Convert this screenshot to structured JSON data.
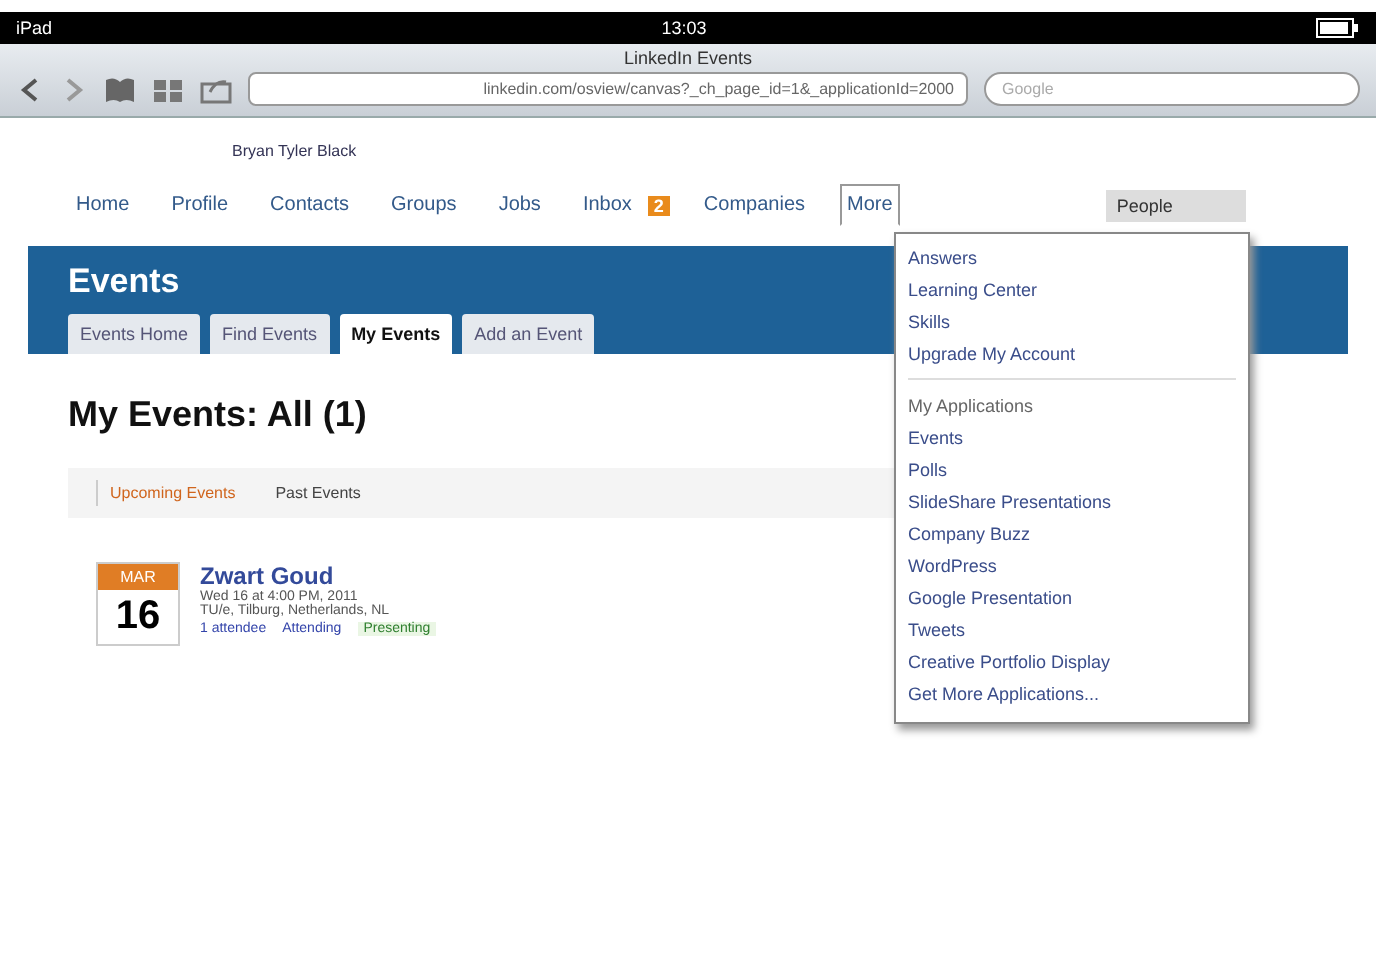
{
  "status_bar": {
    "device": "iPad",
    "time": "13:03"
  },
  "browser": {
    "title": "LinkedIn Events",
    "url": "linkedin.com/osview/canvas?_ch_page_id=1&_applicationId=2000",
    "search_placeholder": "Google"
  },
  "greeting": "Bryan Tyler Black",
  "nav": [
    {
      "label": "Home",
      "selected": false
    },
    {
      "label": "Profile",
      "selected": false
    },
    {
      "label": "Contacts",
      "selected": false
    },
    {
      "label": "Groups",
      "selected": false
    },
    {
      "label": "Jobs",
      "selected": false
    },
    {
      "label": "Inbox",
      "selected": false,
      "badge": "2"
    },
    {
      "label": "Companies",
      "selected": false
    },
    {
      "label": "More",
      "selected": true
    }
  ],
  "people_search": {
    "placeholder": "People"
  },
  "header": {
    "title": "Events"
  },
  "tabs": [
    {
      "label": "Events Home",
      "selected": false
    },
    {
      "label": "Find Events",
      "selected": false
    },
    {
      "label": "My Events",
      "selected": true
    },
    {
      "label": "Add an Event",
      "selected": false
    }
  ],
  "heading": "My Events: All (1)",
  "subtabs": [
    {
      "label": "Upcoming Events",
      "selected": true
    },
    {
      "label": "Past Events",
      "selected": false
    }
  ],
  "events": [
    {
      "month": "MAR",
      "day": "16",
      "title": "Zwart Goud",
      "date": "Wed 16 at 4:00 PM, 2011",
      "location": "TU/e, Tilburg, Netherlands, NL",
      "attendees": "1 attendee",
      "status": "Attending",
      "role": "Presenting"
    }
  ],
  "menu": [
    {
      "kind": "item",
      "label": "Answers"
    },
    {
      "kind": "item",
      "label": "Learning Center"
    },
    {
      "kind": "item",
      "label": "Skills"
    },
    {
      "kind": "item",
      "label": "Upgrade My Account"
    },
    {
      "kind": "header",
      "label": "My Applications"
    },
    {
      "kind": "item",
      "label": "Events"
    },
    {
      "kind": "item",
      "label": "Polls"
    },
    {
      "kind": "item",
      "label": "SlideShare Presentations"
    },
    {
      "kind": "item",
      "label": "Company Buzz"
    },
    {
      "kind": "item",
      "label": "WordPress"
    },
    {
      "kind": "item",
      "label": "Google Presentation"
    },
    {
      "kind": "item",
      "label": "Tweets"
    },
    {
      "kind": "item",
      "label": "Creative Portfolio Display"
    },
    {
      "kind": "item",
      "label": "Get More Applications..."
    }
  ]
}
